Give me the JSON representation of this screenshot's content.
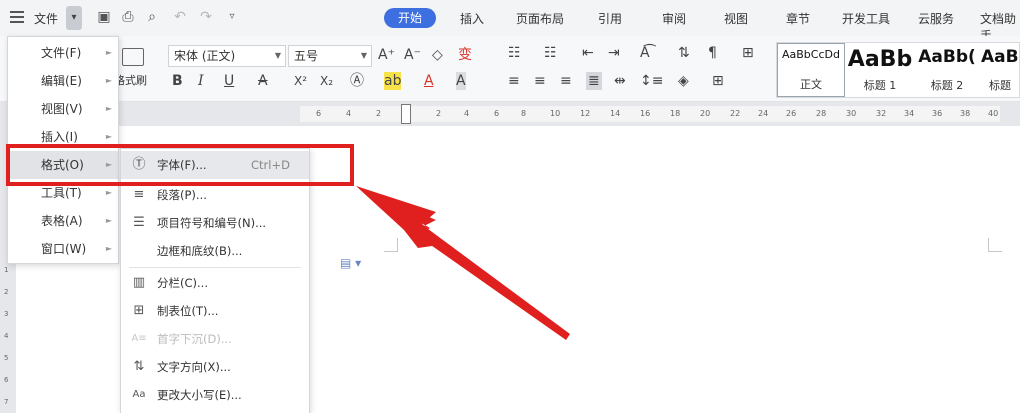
{
  "topbar": {
    "file_label": "文件",
    "dropdown_glyph": "▾",
    "tabs": [
      "开始",
      "插入",
      "页面布局",
      "引用",
      "审阅",
      "视图",
      "章节",
      "开发工具",
      "云服务",
      "文档助手"
    ]
  },
  "ribbon": {
    "format_painter_label": "格式刷",
    "font_name": "宋体 (正文)",
    "font_size": "五号",
    "styles": [
      {
        "preview": "AaBbCcDd",
        "caption": "正文"
      },
      {
        "preview": "AaBb",
        "caption": "标题 1"
      },
      {
        "preview": "AaBb(",
        "caption": "标题 2"
      },
      {
        "preview": "AaBb",
        "caption": "标题"
      }
    ],
    "accent": "#3d6fe0"
  },
  "ruler": {
    "numbers": [
      "6",
      "4",
      "2",
      "2",
      "4",
      "6",
      "8",
      "10",
      "12",
      "14",
      "16",
      "18",
      "20",
      "22",
      "24",
      "26",
      "28",
      "30",
      "32",
      "34",
      "36",
      "38",
      "40"
    ],
    "vertical_numbers": [
      "1",
      "2",
      "3",
      "4",
      "5",
      "6",
      "7"
    ]
  },
  "main_menu": {
    "items": [
      {
        "label": "文件(F)"
      },
      {
        "label": "编辑(E)"
      },
      {
        "label": "视图(V)"
      },
      {
        "label": "插入(I)"
      },
      {
        "label": "格式(O)",
        "selected": true
      },
      {
        "label": "工具(T)"
      },
      {
        "label": "表格(A)"
      },
      {
        "label": "窗口(W)"
      }
    ]
  },
  "format_menu": {
    "items": [
      {
        "label": "字体(F)...",
        "shortcut": "Ctrl+D",
        "icon": "font-circle-icon",
        "glyph": "Ⓣ"
      },
      {
        "label": "段落(P)...",
        "icon": "paragraph-icon",
        "glyph": "≡"
      },
      {
        "label": "项目符号和编号(N)...",
        "icon": "bullets-icon",
        "glyph": "☰"
      },
      {
        "label": "边框和底纹(B)...",
        "icon": "",
        "glyph": ""
      },
      {
        "label": "分栏(C)...",
        "icon": "columns-icon",
        "glyph": "▥"
      },
      {
        "label": "制表位(T)...",
        "icon": "tab-stop-icon",
        "glyph": "⊞"
      },
      {
        "label": "首字下沉(D)...",
        "icon": "drop-cap-icon",
        "glyph": "A≡",
        "disabled": true
      },
      {
        "label": "文字方向(X)...",
        "icon": "text-direction-icon",
        "glyph": "⇅"
      },
      {
        "label": "更改大小写(E)...",
        "icon": "change-case-icon",
        "glyph": "Aa"
      }
    ]
  },
  "annotation": {
    "color": "#e0201e"
  }
}
